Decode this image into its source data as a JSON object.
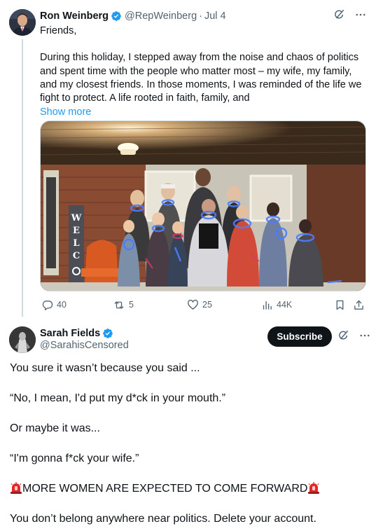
{
  "tweet1": {
    "author_name": "Ron Weinberg",
    "handle": "@RepWeinberg",
    "separator": "·",
    "date": "Jul 4",
    "text_lines": [
      "Friends,",
      "During this holiday, I stepped away from the noise and chaos of politics and spent time with the people who matter most – my wife, my family, and my closest friends. In those moments, I was reminded of the life we fight to protect. A life rooted in faith, family, and"
    ],
    "show_more": "Show more",
    "photo_sign_letters": "WELC",
    "stats": {
      "replies": "40",
      "reposts": "5",
      "likes": "25",
      "views": "44K"
    }
  },
  "tweet2": {
    "author_name": "Sarah Fields",
    "handle": "@SarahisCensored",
    "subscribe_label": "Subscribe",
    "body": {
      "line1": "You sure it wasn’t because you said ...",
      "line2": "“No, I mean, I'd put my d*ck in your mouth.”",
      "line3": "Or maybe it was...",
      "line4": "“I'm gonna f*ck your wife.”",
      "line5": "MORE WOMEN ARE EXPECTED TO COME FORWARD",
      "line6": "You don’t belong anywhere near politics. Delete your account."
    }
  },
  "colors": {
    "verified_blue": "#1d9bf0",
    "link_blue": "#1d9bf0",
    "secondary_text": "#536471",
    "primary_text": "#0f1419",
    "subscribe_bg": "#0f1419"
  },
  "icons": [
    "verified-badge-icon",
    "grok-icon",
    "more-icon",
    "reply-icon",
    "repost-icon",
    "like-icon",
    "views-icon",
    "bookmark-icon",
    "share-icon",
    "alert-siren-icon"
  ]
}
